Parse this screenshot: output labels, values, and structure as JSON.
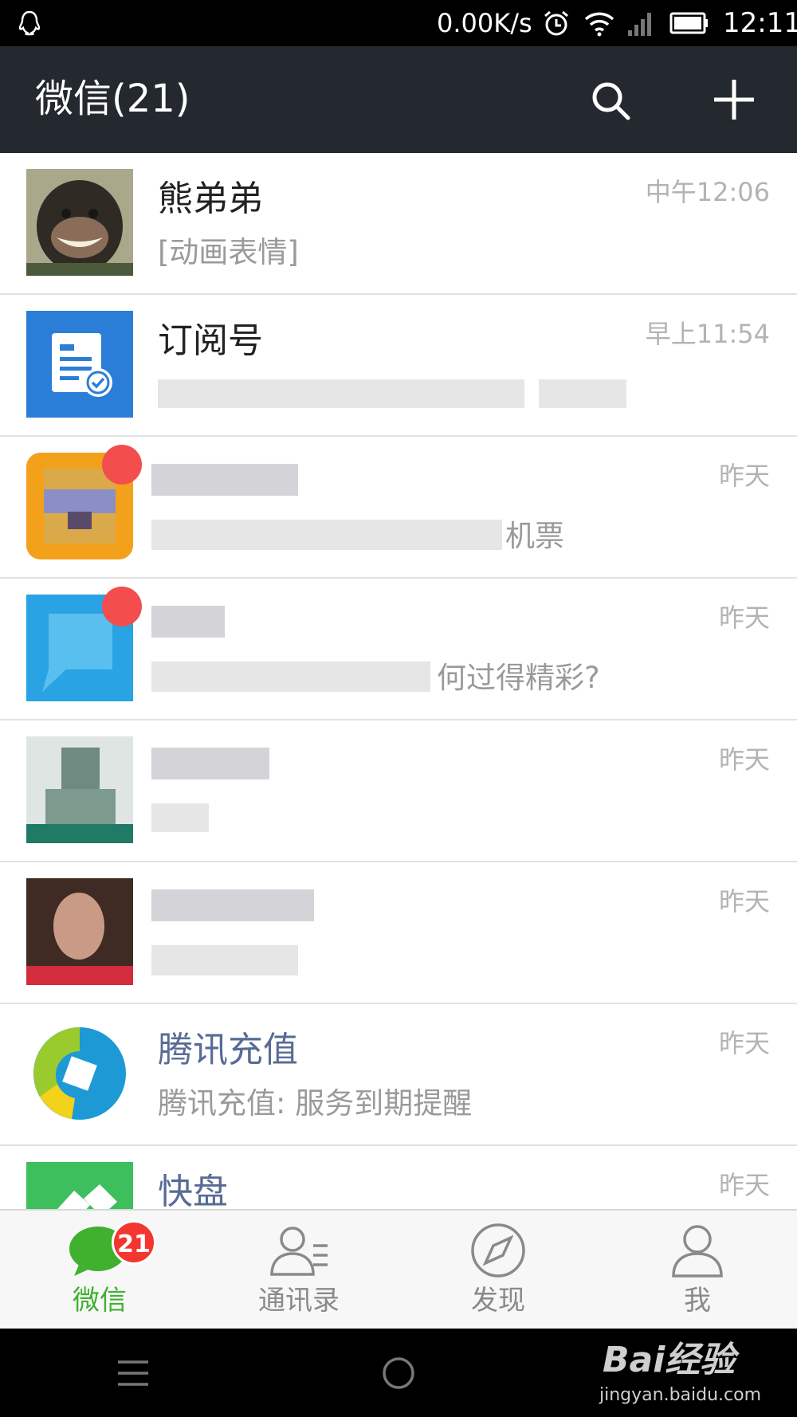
{
  "status_bar": {
    "speed": "0.00K/s",
    "time": "12:11"
  },
  "header": {
    "title": "微信(21)"
  },
  "chats": [
    {
      "name": "熊弟弟",
      "preview": "[动画表情]",
      "time": "中午12:06"
    },
    {
      "name": "订阅号",
      "preview": "",
      "time": "早上11:54"
    },
    {
      "name": "",
      "preview": "机票",
      "time": "昨天"
    },
    {
      "name": "",
      "preview": "何过得精彩?",
      "time": "昨天"
    },
    {
      "name": "",
      "preview": "",
      "time": "昨天"
    },
    {
      "name": "",
      "preview": "",
      "time": "昨天"
    },
    {
      "name": "腾讯充值",
      "preview": "腾讯充值: 服务到期提醒",
      "time": "昨天"
    },
    {
      "name": "快盘",
      "preview": "",
      "time": "昨天"
    }
  ],
  "tabs": [
    {
      "label": "微信",
      "badge": "21",
      "active": true
    },
    {
      "label": "通讯录"
    },
    {
      "label": "发现"
    },
    {
      "label": "我"
    }
  ],
  "colors": {
    "header_bg": "#23292e",
    "accent_green": "#3fb12f",
    "badge_red": "#f43530",
    "official_name_blue": "#576b95"
  },
  "watermark": {
    "main": "Bai经验",
    "sub": "jingyan.baidu.com"
  }
}
